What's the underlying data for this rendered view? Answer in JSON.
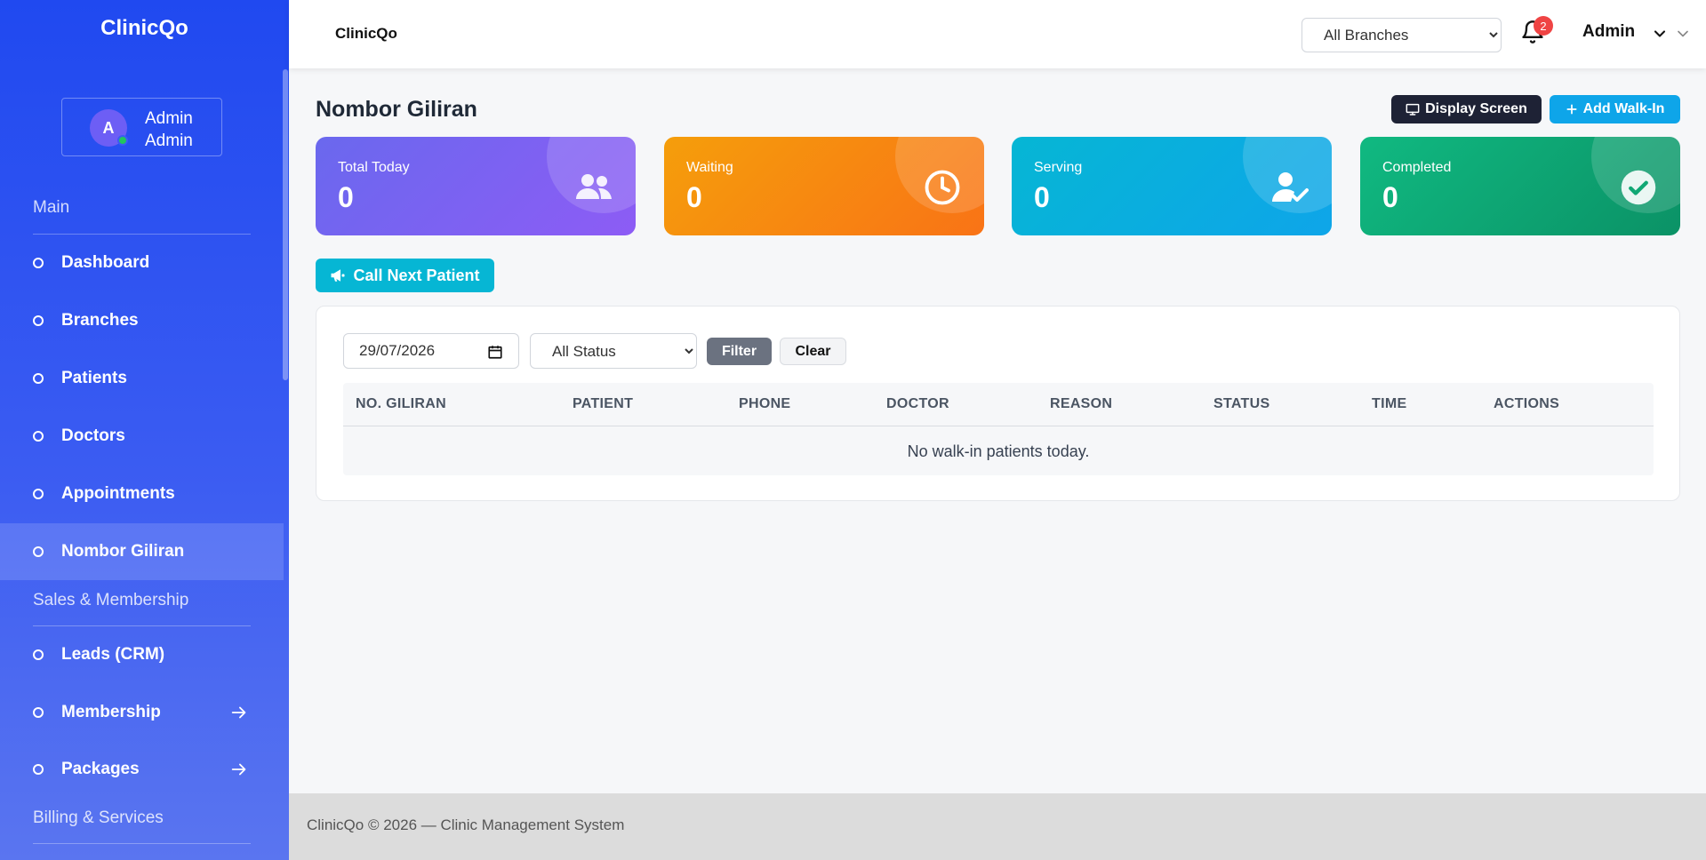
{
  "app": {
    "brand": "ClinicQo",
    "header_title": "ClinicQo"
  },
  "user_card": {
    "avatar_letter": "A",
    "name": "Admin",
    "role": "Admin"
  },
  "sidebar": {
    "sections": [
      "Main",
      "Sales & Membership",
      "Billing & Services"
    ],
    "items": [
      {
        "label": "Dashboard",
        "active": false
      },
      {
        "label": "Branches",
        "active": false
      },
      {
        "label": "Patients",
        "active": false
      },
      {
        "label": "Doctors",
        "active": false
      },
      {
        "label": "Appointments",
        "active": false
      },
      {
        "label": "Nombor Giliran",
        "active": true
      },
      {
        "label": "Leads (CRM)",
        "active": false
      },
      {
        "label": "Membership",
        "active": false,
        "has_arrow": true
      },
      {
        "label": "Packages",
        "active": false,
        "has_arrow": true
      }
    ]
  },
  "header": {
    "branch_select": {
      "selected": "All Branches",
      "options": [
        "All Branches"
      ]
    },
    "notification_count": "2",
    "admin_label": "Admin"
  },
  "page": {
    "title": "Nombor Giliran",
    "display_screen_label": "Display Screen",
    "add_walkin_label": "Add Walk-In",
    "call_next_label": "Call Next Patient"
  },
  "stats": [
    {
      "label": "Total Today",
      "value": "0",
      "icon": "users-icon",
      "color": "#7c6cf3"
    },
    {
      "label": "Waiting",
      "value": "0",
      "icon": "clock-icon",
      "color": "#f7931e"
    },
    {
      "label": "Serving",
      "value": "0",
      "icon": "user-check-icon",
      "color": "#0bb3dc"
    },
    {
      "label": "Completed",
      "value": "0",
      "icon": "check-circle-icon",
      "color": "#15a876"
    }
  ],
  "filters": {
    "date_value": "29/07/2026",
    "status_select": {
      "selected": "All Status",
      "options": [
        "All Status"
      ]
    },
    "filter_label": "Filter",
    "clear_label": "Clear"
  },
  "table": {
    "columns": [
      "NO. GILIRAN",
      "PATIENT",
      "PHONE",
      "DOCTOR",
      "REASON",
      "STATUS",
      "TIME",
      "ACTIONS"
    ],
    "empty_message": "No walk-in patients today."
  },
  "footer": {
    "text": "ClinicQo © 2026 — Clinic Management System"
  }
}
